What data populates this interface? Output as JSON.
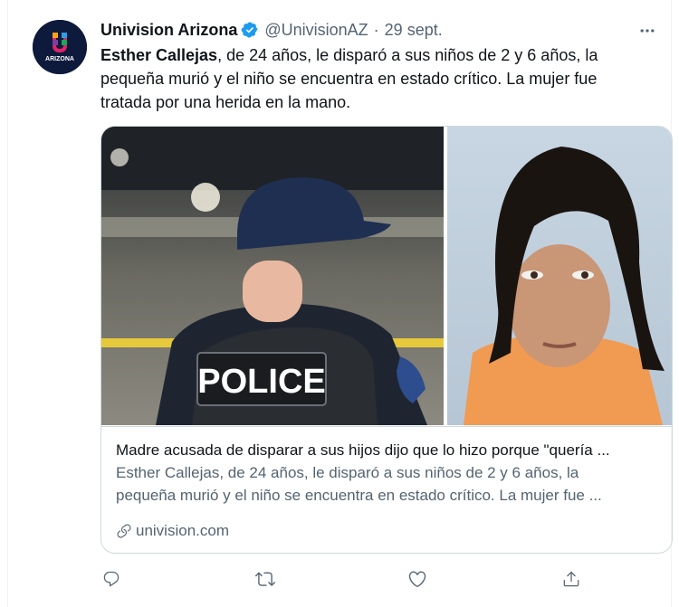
{
  "tweet": {
    "author_name": "Univision Arizona",
    "handle": "@UnivisionAZ",
    "separator": "·",
    "date": "29 sept.",
    "avatar_label": "ARIZONA",
    "text_bold": "Esther Callejas",
    "text_rest": ", de 24 años, le disparó a sus niños de 2 y 6 años, la pequeña murió y el niño se encuentra en estado crítico. La mujer fue tratada por una herida en la mano."
  },
  "card": {
    "image_label": "POLICE",
    "title": "Madre acusada de disparar a sus hijos dijo que lo hizo porque \"quería ...",
    "description_line1": "Esther Callejas, de 24 años, le disparó a sus niños de 2 y 6 años, la",
    "description_line2": "pequeña murió y el niño se encuentra en estado crítico. La mujer fue ...",
    "domain": "univision.com"
  },
  "icons": {
    "verified": "verified-badge-icon",
    "more": "more-icon",
    "reply": "reply-icon",
    "retweet": "retweet-icon",
    "like": "like-icon",
    "share": "share-icon",
    "link": "link-icon"
  },
  "colors": {
    "verified_blue": "#1d9bf0",
    "text_primary": "#0f1419",
    "text_secondary": "#536471",
    "border": "#cfd9de"
  }
}
